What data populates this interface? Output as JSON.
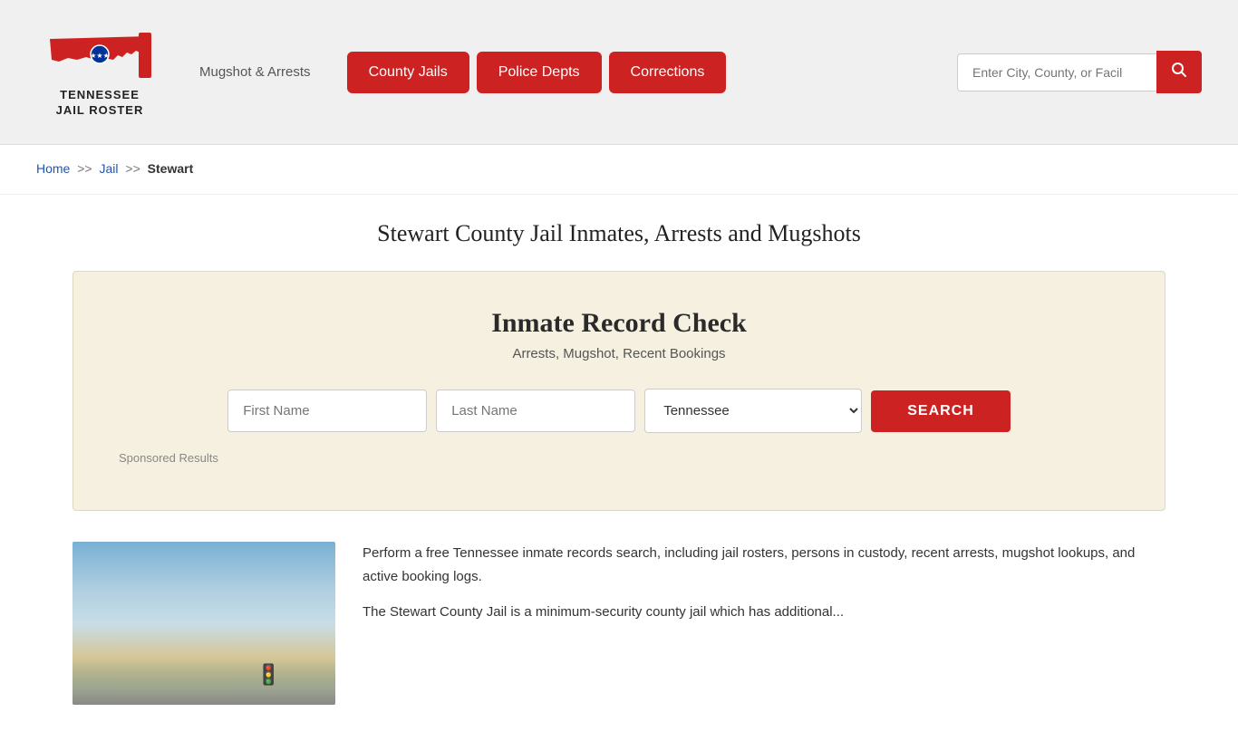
{
  "header": {
    "logo_line1": "TENNESSEE",
    "logo_line2": "JAIL ROSTER",
    "mugshot_link": "Mugshot & Arrests",
    "nav": {
      "county_jails": "County Jails",
      "police_depts": "Police Depts",
      "corrections": "Corrections"
    },
    "search_placeholder": "Enter City, County, or Facil"
  },
  "breadcrumb": {
    "home": "Home",
    "sep1": ">>",
    "jail": "Jail",
    "sep2": ">>",
    "current": "Stewart"
  },
  "page_title": "Stewart County Jail Inmates, Arrests and Mugshots",
  "record_check": {
    "title": "Inmate Record Check",
    "subtitle": "Arrests, Mugshot, Recent Bookings",
    "first_name_placeholder": "First Name",
    "last_name_placeholder": "Last Name",
    "state_default": "Tennessee",
    "search_btn": "SEARCH",
    "sponsored_label": "Sponsored Results"
  },
  "bottom": {
    "paragraph1": "Perform a free Tennessee inmate records search, including jail rosters, persons in custody, recent arrests, mugshot lookups, and active booking logs.",
    "paragraph2": "The Stewart County Jail is a minimum-security county jail which has additional..."
  }
}
